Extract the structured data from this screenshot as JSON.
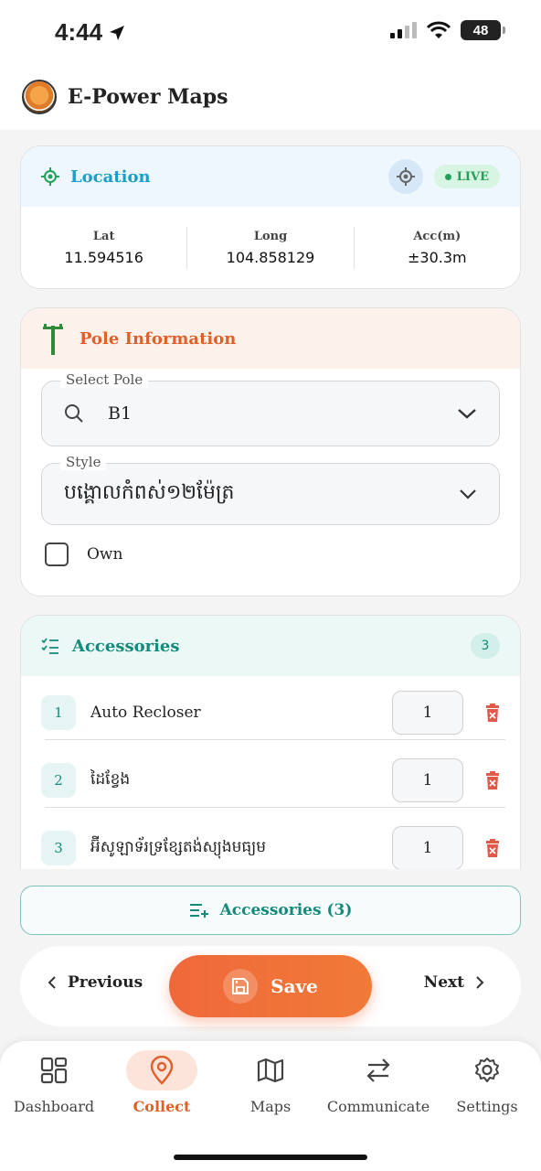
{
  "status_bar": {
    "time": "4:44",
    "battery": "48"
  },
  "header": {
    "title": "E-Power Maps"
  },
  "location": {
    "title": "Location",
    "live_label": "LIVE",
    "lat_label": "Lat",
    "lat_value": "11.594516",
    "long_label": "Long",
    "long_value": "104.858129",
    "acc_label": "Acc(m)",
    "acc_value": "±30.3m"
  },
  "pole": {
    "title": "Pole Information",
    "select_label": "Select Pole",
    "select_value": "B1",
    "style_label": "Style",
    "style_value": "បង្គោលកំពស់១២ម៉ែត្រ",
    "own_label": "Own"
  },
  "accessories": {
    "title": "Accessories",
    "count": "3",
    "items": [
      {
        "index": "1",
        "name": "Auto Recloser",
        "qty": "1"
      },
      {
        "index": "2",
        "name": "ដៃខ្វែង",
        "qty": "1"
      },
      {
        "index": "3",
        "name": "អ៊ីសូឡាទ័រទ្រខ្សែតង់ស្យុងមធ្យម",
        "qty": "1"
      }
    ]
  },
  "actions": {
    "accessories_button": "Accessories (3)",
    "previous": "Previous",
    "save": "Save",
    "next": "Next"
  },
  "tabs": [
    {
      "label": "Dashboard",
      "icon": "dashboard-icon"
    },
    {
      "label": "Collect",
      "icon": "location-pin-icon",
      "active": true
    },
    {
      "label": "Maps",
      "icon": "map-icon"
    },
    {
      "label": "Communicate",
      "icon": "arrows-exchange-icon"
    },
    {
      "label": "Settings",
      "icon": "gear-icon"
    }
  ],
  "colors": {
    "accent_orange": "#e0602a",
    "location_blue": "#1aa0c8",
    "teal": "#138a7a",
    "live_green": "#22a05a",
    "delete_red": "#e05a4a"
  }
}
